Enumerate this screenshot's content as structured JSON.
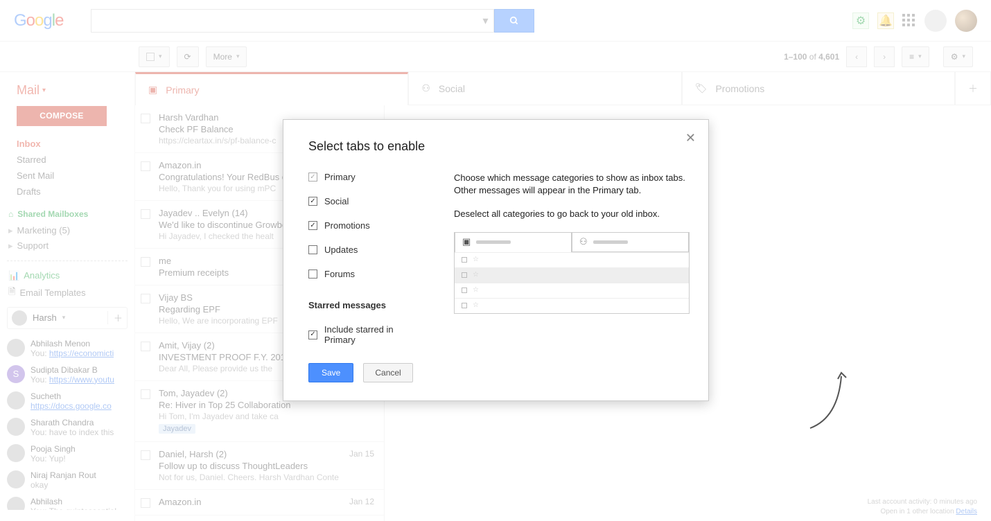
{
  "logo_chars": [
    "G",
    "o",
    "o",
    "g",
    "l",
    "e"
  ],
  "header": {
    "search_placeholder": ""
  },
  "toolbar": {
    "more": "More",
    "counter_a": "1–100",
    "counter_of": " of ",
    "counter_b": "4,601"
  },
  "mail_label": "Mail",
  "compose": "COMPOSE",
  "nav": [
    {
      "label": "Inbox",
      "active": true
    },
    {
      "label": "Starred"
    },
    {
      "label": "Sent Mail"
    },
    {
      "label": "Drafts"
    }
  ],
  "shared_label": "Shared Mailboxes",
  "folders": [
    {
      "label": "Marketing (5)"
    },
    {
      "label": "Support"
    }
  ],
  "analytics": "Analytics",
  "email_templates": "Email Templates",
  "user_switch": "Harsh",
  "hangouts": [
    {
      "name": "Abhilash Menon",
      "sub_prefix": "You: ",
      "link": "https://economicti"
    },
    {
      "name": "Sudipta Dibakar B",
      "sub_prefix": "You: ",
      "link": "https://www.youtu",
      "av": "violet",
      "initial": "S"
    },
    {
      "name": "Sucheth",
      "sub_prefix": "",
      "link": "https://docs.google.co"
    },
    {
      "name": "Sharath Chandra",
      "sub": "You: have to index this"
    },
    {
      "name": "Pooja Singh",
      "sub": "You: Yup!"
    },
    {
      "name": "Niraj Ranjan Rout",
      "sub": "okay"
    },
    {
      "name": "Abhilash",
      "sub": "You: The quintessential"
    }
  ],
  "tabs": [
    {
      "label": "Primary",
      "icon": "inbox",
      "active": true
    },
    {
      "label": "Social",
      "icon": "people"
    },
    {
      "label": "Promotions",
      "icon": "tag"
    }
  ],
  "messages": [
    {
      "from": "Harsh Vardhan",
      "subj": "Check PF Balance",
      "prev": "https://cleartax.in/s/pf-balance-c",
      "date": ""
    },
    {
      "from": "Amazon.in",
      "subj": "Congratulations! Your RedBus c",
      "prev": "Hello, Thank you for using mPC",
      "date": ""
    },
    {
      "from": "Jayadev .. Evelyn (14)",
      "subj": "We'd like to discontinue Growbo",
      "prev": "Hi Jayadev, I checked the healt",
      "date": ""
    },
    {
      "from": "me",
      "subj": "Premium receipts",
      "prev": "",
      "date": ""
    },
    {
      "from": "Vijay BS",
      "subj": "Regarding EPF",
      "prev": "Hello, We are incorporating EPF",
      "date": ""
    },
    {
      "from": "Amit, Vijay (2)",
      "subj": "INVESTMENT PROOF F.Y. 201",
      "prev": "Dear All, Please provide us the",
      "date": ""
    },
    {
      "from": "Tom, Jayadev (2)",
      "subj": "Re: Hiver in Top 25 Collaboration",
      "prev": "Hi Tom, I'm Jayadev and take ca",
      "date": "",
      "chip": "Jayadev"
    },
    {
      "from": "Daniel, Harsh (2)",
      "subj": "Follow up to discuss ThoughtLeaders",
      "prev": "Not for us, Daniel. Cheers. Harsh Vardhan Conte",
      "date": "Jan 15"
    },
    {
      "from": "Amazon.in",
      "subj": "",
      "prev": "",
      "date": "Jan 12"
    }
  ],
  "footer": {
    "line1": "Last account activity: 0 minutes ago",
    "line2_a": "Open in 1 other location ",
    "line2_link": "Details"
  },
  "dialog": {
    "title": "Select tabs to enable",
    "options": [
      {
        "label": "Primary",
        "checked": true,
        "locked": true
      },
      {
        "label": "Social",
        "checked": true
      },
      {
        "label": "Promotions",
        "checked": true
      },
      {
        "label": "Updates",
        "checked": false
      },
      {
        "label": "Forums",
        "checked": false
      }
    ],
    "starred_heading": "Starred messages",
    "starred_opt": "Include starred in Primary",
    "info_p1": "Choose which message categories to show as inbox tabs. Other messages will appear in the Primary tab.",
    "info_p2": "Deselect all categories to go back to your old inbox.",
    "save": "Save",
    "cancel": "Cancel"
  }
}
